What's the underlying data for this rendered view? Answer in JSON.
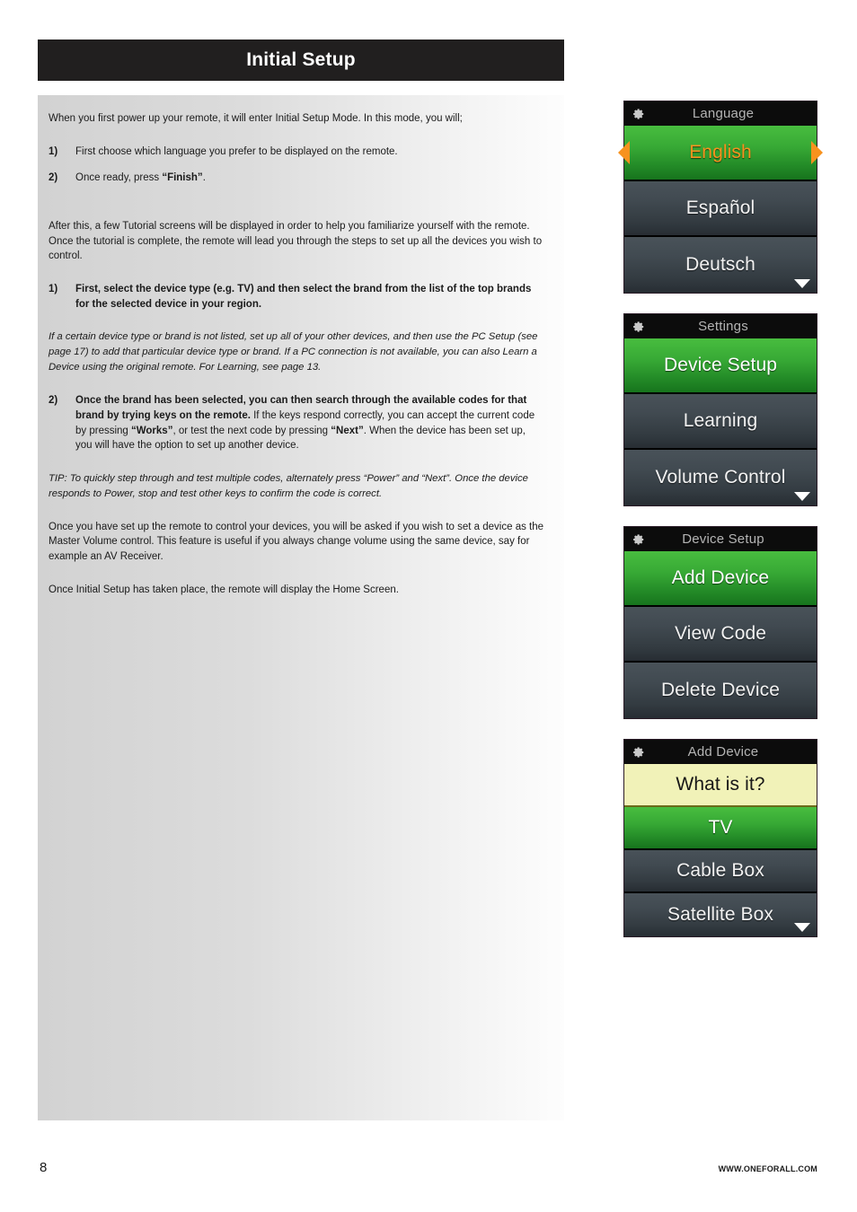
{
  "header": {
    "title": "Initial Setup"
  },
  "content": {
    "intro": "When you first power up your remote, it will enter Initial Setup Mode. In this mode, you will;",
    "steps_a": [
      {
        "num": "1)",
        "text": "First choose which language you prefer to be displayed on the remote."
      },
      {
        "num": "2)",
        "text_pre": "Once ready, press ",
        "text_bold": "“Finish”",
        "text_post": "."
      }
    ],
    "para_after_tutorial": "After this, a few Tutorial screens will be displayed in order to help you familiarize yourself with the remote. Once the tutorial is complete, the remote will lead you through the steps to set up all the devices you wish to control.",
    "step_b1_num": "1)",
    "step_b1_text": "First, select the device type (e.g. TV) and then select the brand from the list of the top brands for the selected device in your region.",
    "italic_note_1": "If a certain device type or brand is not listed, set up all of your other devices, and then use the PC Setup (see page 17) to add that particular device type or brand. If a PC connection is not available, you can also Learn a Device using the original remote. For Learning, see page 13.",
    "step_b2_num": "2)",
    "step_b2_bold": "Once the brand has been selected, you can then search through the available codes for that brand by trying keys on the remote.",
    "step_b2_mid1": " If the keys respond correctly, you can accept the current code by pressing ",
    "step_b2_bold2": "“Works”",
    "step_b2_mid2": ", or test the next code by pressing ",
    "step_b2_bold3": "“Next”",
    "step_b2_end": ". When the device has been set up, you will have the option to set up another device.",
    "italic_note_2": "TIP: To quickly step through and test multiple codes, alternately press “Power” and “Next”. Once the device responds to Power, stop and test other keys to confirm the code is correct.",
    "para_master_volume": "Once you have set up the remote to control your devices, you will be asked if you wish to set a device as the Master Volume control. This feature is useful if you always change volume using the same device, say for example an AV Receiver.",
    "para_home_screen": "Once Initial Setup has taken place, the remote will display the Home Screen."
  },
  "screens": [
    {
      "id": "language",
      "title": "Language",
      "icon": "gear-icon",
      "has_scroll_caret": true,
      "rows": [
        {
          "label": "English",
          "state": "selected-orange",
          "arrows": true
        },
        {
          "label": "Español",
          "state": "normal",
          "arrows": false
        },
        {
          "label": "Deutsch",
          "state": "normal",
          "arrows": false
        }
      ]
    },
    {
      "id": "settings",
      "title": "Settings",
      "icon": "gear-icon",
      "has_scroll_caret": true,
      "rows": [
        {
          "label": "Device Setup",
          "state": "selected",
          "arrows": false
        },
        {
          "label": "Learning",
          "state": "normal",
          "arrows": false
        },
        {
          "label": "Volume Control",
          "state": "normal",
          "arrows": false
        }
      ]
    },
    {
      "id": "device-setup",
      "title": "Device Setup",
      "icon": "gear-icon",
      "has_scroll_caret": false,
      "rows": [
        {
          "label": "Add Device",
          "state": "selected",
          "arrows": false
        },
        {
          "label": "View Code",
          "state": "normal",
          "arrows": false
        },
        {
          "label": "Delete Device",
          "state": "normal",
          "arrows": false
        }
      ]
    },
    {
      "id": "add-device",
      "title": "Add Device",
      "icon": "gear-icon",
      "has_scroll_caret": true,
      "rows": [
        {
          "label": "What is it?",
          "state": "prompt",
          "arrows": false
        },
        {
          "label": "TV",
          "state": "selected",
          "arrows": false
        },
        {
          "label": "Cable Box",
          "state": "normal",
          "arrows": false
        },
        {
          "label": "Satellite Box",
          "state": "normal",
          "arrows": false
        }
      ]
    }
  ],
  "footer": {
    "page_number": "8",
    "site_url": "WWW.ONEFORALL.COM"
  },
  "colors": {
    "header_bg": "#211f1f",
    "accent_green": "#37a935",
    "accent_orange": "#f7921e",
    "prompt_yellow": "#f1f2b8",
    "row_dark": "#3b444b",
    "title_bar": "#0c0c0c"
  }
}
